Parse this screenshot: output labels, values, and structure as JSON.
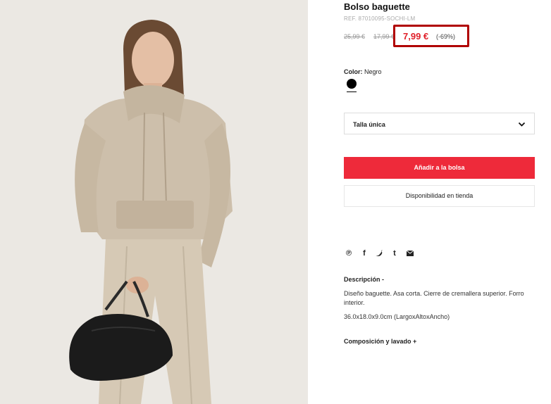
{
  "product": {
    "title": "Bolso baguette",
    "ref": "REF. 87010095-SOCHI-LM",
    "old_price_1": "25,99 €",
    "old_price_2": "17,99 €",
    "price": "7,99 €",
    "discount": "(-69%)"
  },
  "color": {
    "label": "Color:",
    "value": "Negro",
    "swatch": "#000000"
  },
  "size": {
    "selected": "Talla única"
  },
  "buttons": {
    "add_to_bag": "Añadir a la bolsa",
    "store_availability": "Disponibilidad en tienda"
  },
  "share": {
    "icons": [
      "pinterest-icon",
      "facebook-icon",
      "twitter-icon",
      "tumblr-icon",
      "email-icon"
    ]
  },
  "description": {
    "heading": "Descripción -",
    "text": "Diseño baguette. Asa corta. Cierre de cremallera superior. Forro interior.",
    "dimensions": "36.0x18.0x9.0cm (LargoxAltoxAncho)"
  },
  "composition": {
    "heading": "Composición y lavado +"
  },
  "colors": {
    "accent": "#ee2a3a",
    "price_red": "#e0202a",
    "highlight_border": "#b00000"
  }
}
